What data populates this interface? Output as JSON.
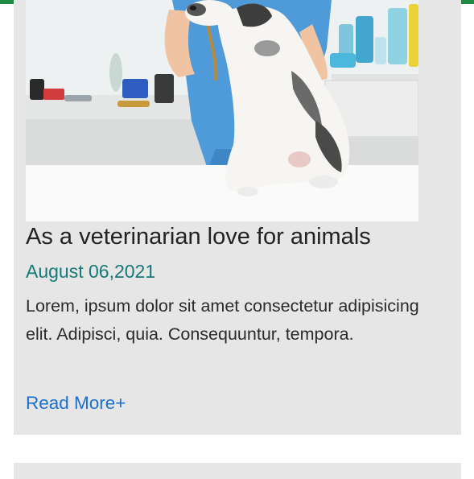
{
  "post": {
    "title": "As a veterinarian love for animals",
    "date": "August 06,2021",
    "excerpt": "Lorem, ipsum dolor sit amet consectetur adipisicing elit. Adipisci, quia. Consequuntur, tempora.",
    "read_more": "Read More+"
  },
  "colors": {
    "top_bar": "#1e8a43",
    "date": "#137a78",
    "link": "#1a6fd1",
    "card_bg": "#e6e6e6"
  }
}
